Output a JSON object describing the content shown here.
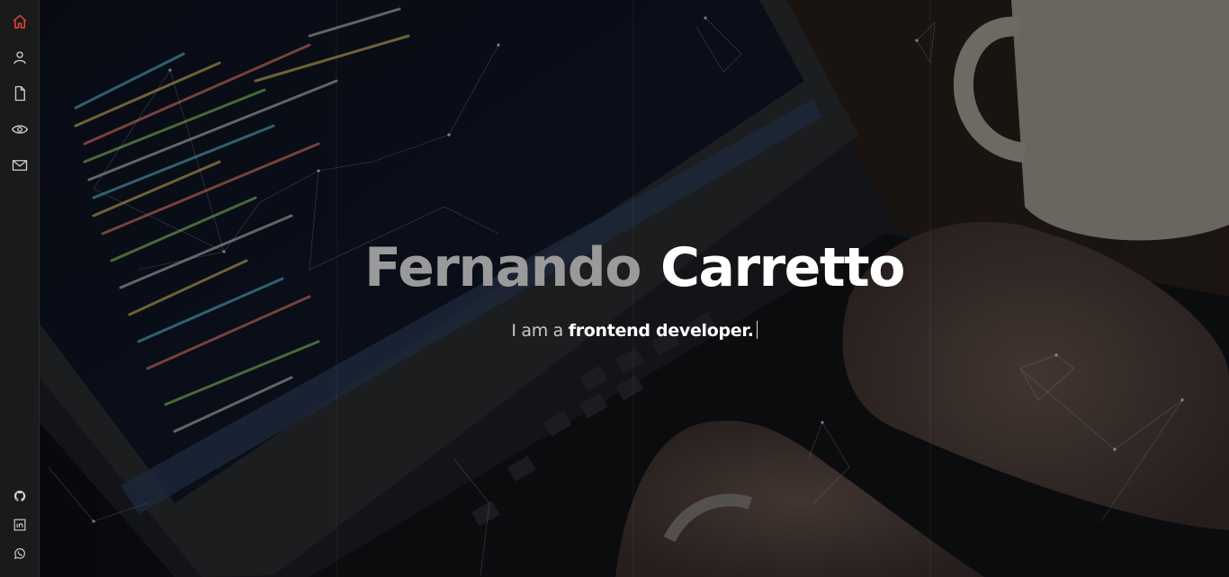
{
  "sidebar": {
    "nav": [
      {
        "icon": "home-icon",
        "active": true
      },
      {
        "icon": "user-icon",
        "active": false
      },
      {
        "icon": "document-icon",
        "active": false
      },
      {
        "icon": "eye-icon",
        "active": false
      },
      {
        "icon": "mail-icon",
        "active": false
      }
    ],
    "social": [
      "github-icon",
      "linkedin-icon",
      "whatsapp-icon"
    ]
  },
  "hero": {
    "first_name": "Fernando",
    "last_name": "Carretto",
    "subtitle_prefix": "I am a",
    "subtitle_role": "frontend developer."
  },
  "colors": {
    "accent": "#e5473c",
    "sidebar_bg": "#1a1a1b",
    "icon": "#cfcfcf",
    "first_name": "#9a9a9a",
    "last_name": "#ffffff"
  }
}
